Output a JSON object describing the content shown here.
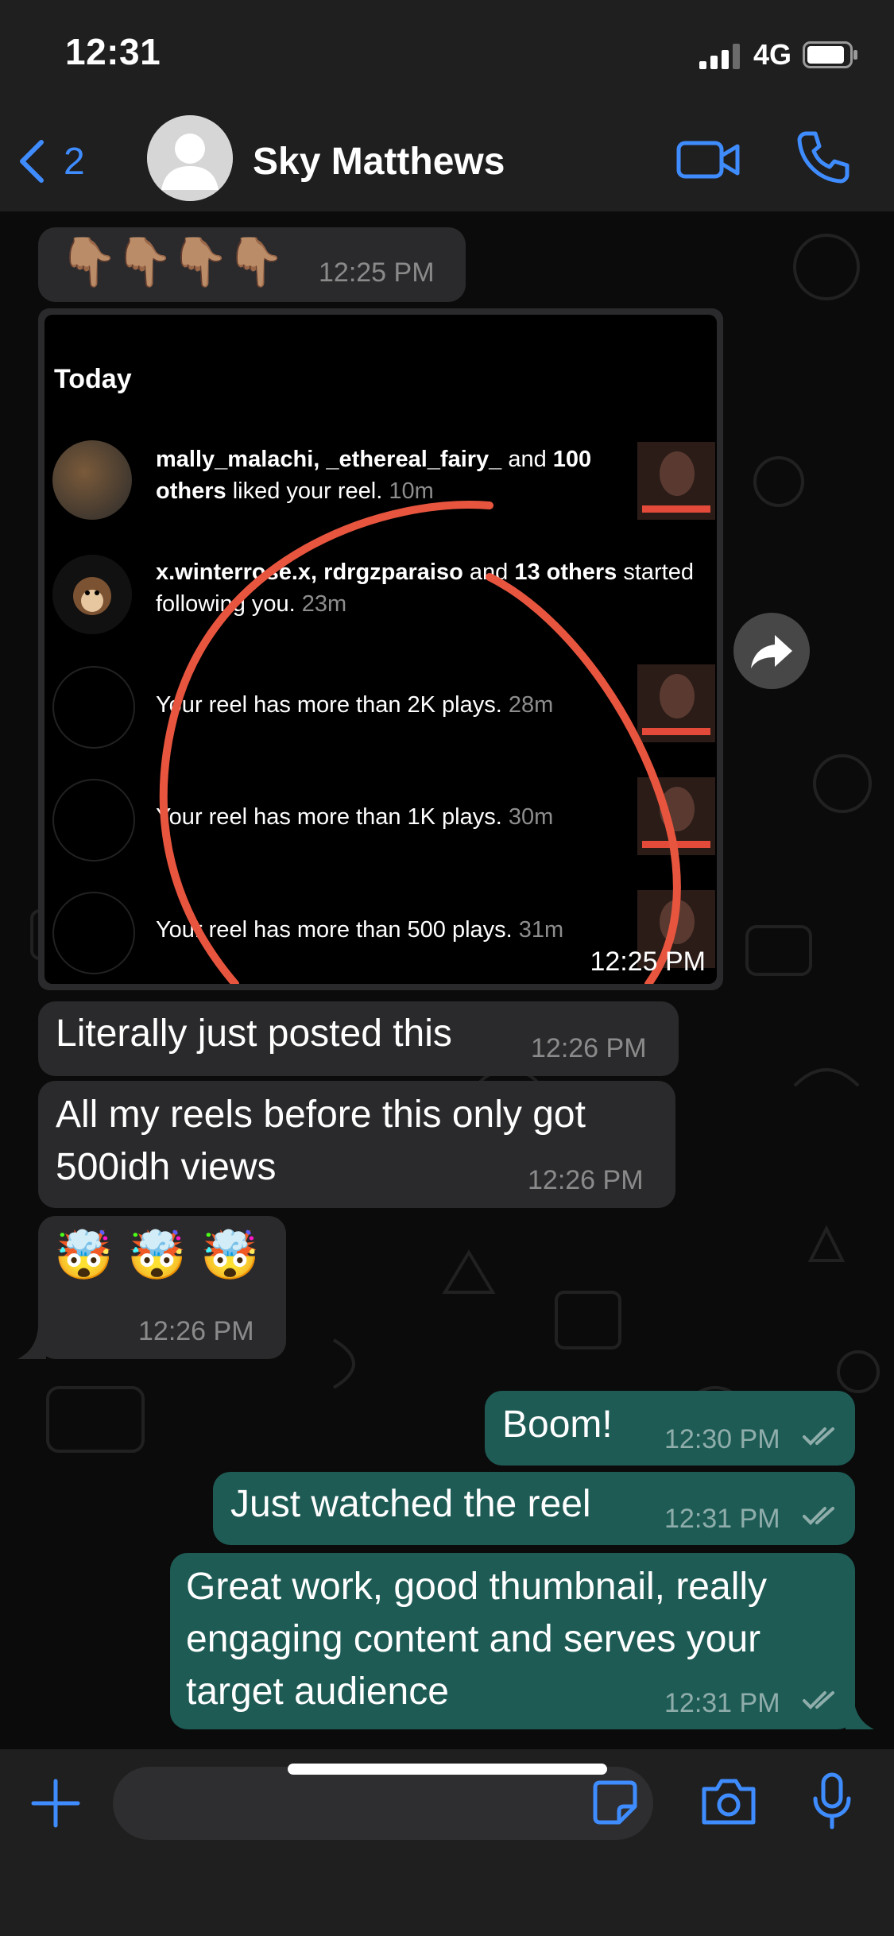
{
  "status_bar": {
    "time": "12:31",
    "network": "4G"
  },
  "header": {
    "back_count": "2",
    "contact_name": "Sky Matthews"
  },
  "messages": [
    {
      "emoji": [
        "👇🏽",
        "👇🏽",
        "👇🏽",
        "👇🏽"
      ],
      "time": "12:25 PM"
    },
    {
      "image": {
        "today": "Today",
        "n1": {
          "user1": "mally_malachi",
          "sep": ", ",
          "user2": "_ethereal_fairy_",
          "and": " and ",
          "count": "100",
          "others": "others",
          "rest": " liked your reel. ",
          "age": "10m"
        },
        "n2": {
          "user1": "x.winterrose.x",
          "sep": ", ",
          "user2": "rdrgzparaiso",
          "and": " and ",
          "count": "13 others",
          "rest": " started following you. ",
          "age": "23m"
        },
        "n3": {
          "text": "Your reel has more than 2K plays. ",
          "age": "28m"
        },
        "n4": {
          "text": "Your reel has more than 1K plays. ",
          "age": "30m"
        },
        "n5": {
          "text": "Your reel has more than 500 plays. ",
          "age": "31m"
        },
        "time": "12:25 PM"
      }
    },
    {
      "text": "Literally just posted this",
      "time": "12:26 PM"
    },
    {
      "text_line1": "All my reels before this only got",
      "text_line2": "500idh views",
      "time": "12:26 PM"
    },
    {
      "emoji": [
        "🤯",
        "🤯",
        "🤯"
      ],
      "time": "12:26 PM"
    },
    {
      "text": "Boom!",
      "time": "12:30 PM"
    },
    {
      "text": "Just watched the reel",
      "time": "12:31 PM"
    },
    {
      "line1": "Great work, good thumbnail, really",
      "line2": "engaging content and serves your",
      "line3": "target audience",
      "time": "12:31 PM"
    }
  ],
  "input": {
    "placeholder": ""
  },
  "colors": {
    "accent": "#3f8cff",
    "incoming": "#2a2a2c",
    "outgoing": "#1e5b55",
    "annotation": "#e8553f"
  }
}
